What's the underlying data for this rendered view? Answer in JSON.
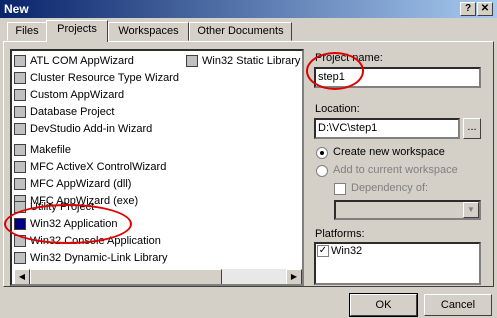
{
  "window": {
    "title": "New",
    "help_label": "?",
    "close_label": "✕"
  },
  "tabs": [
    {
      "label": "Files"
    },
    {
      "label": "Projects"
    },
    {
      "label": "Workspaces"
    },
    {
      "label": "Other Documents"
    }
  ],
  "project_types": [
    "ATL COM AppWizard",
    "Cluster Resource Type Wizard",
    "Custom AppWizard",
    "Database Project",
    "DevStudio Add-in Wizard",
    "Makefile",
    "MFC ActiveX ControlWizard",
    "MFC AppWizard (dll)",
    "MFC AppWizard (exe)",
    "Utility Project",
    "Win32 Application",
    "Win32 Console Application",
    "Win32 Dynamic-Link Library",
    "Win32 Static Library"
  ],
  "selected_project_type": "Win32 Application",
  "project_name": {
    "label": "Project name:",
    "value": "step1"
  },
  "location": {
    "label": "Location:",
    "value": "D:\\VC\\step1",
    "browse_label": "..."
  },
  "workspace": {
    "create_label": "Create new workspace",
    "add_label": "Add to current workspace",
    "dependency_label": "Dependency of:"
  },
  "platforms": {
    "label": "Platforms:",
    "items": [
      "Win32"
    ]
  },
  "buttons": {
    "ok": "OK",
    "cancel": "Cancel"
  },
  "annotation_color": "#e00000"
}
